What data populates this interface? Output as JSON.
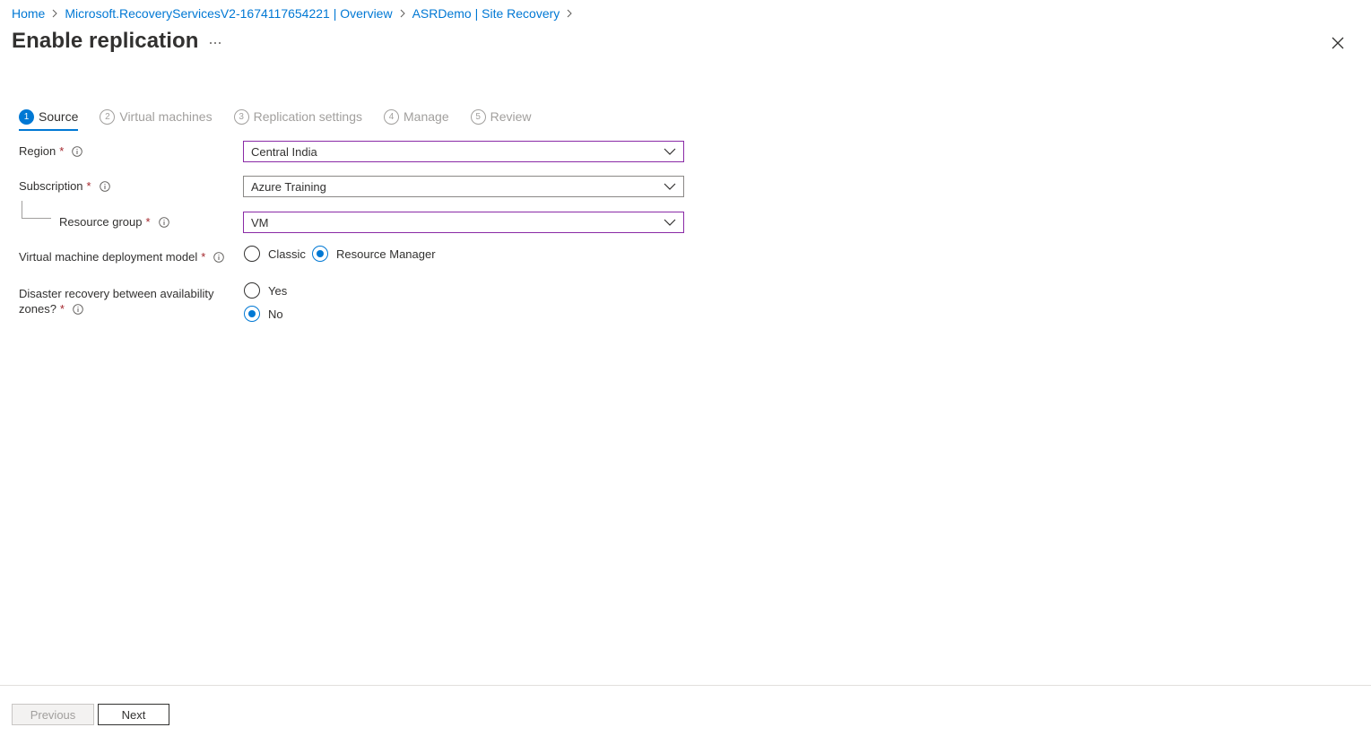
{
  "breadcrumb": [
    {
      "label": "Home"
    },
    {
      "label": "Microsoft.RecoveryServicesV2-1674117654221 | Overview"
    },
    {
      "label": "ASRDemo | Site Recovery"
    }
  ],
  "title": "Enable replication",
  "more_label": "...",
  "tabs": [
    {
      "num": "1",
      "label": "Source",
      "active": true
    },
    {
      "num": "2",
      "label": "Virtual machines"
    },
    {
      "num": "3",
      "label": "Replication settings"
    },
    {
      "num": "4",
      "label": "Manage"
    },
    {
      "num": "5",
      "label": "Review"
    }
  ],
  "form": {
    "region": {
      "label": "Region",
      "required": "*",
      "value": "Central India"
    },
    "subscription": {
      "label": "Subscription",
      "required": "*",
      "value": "Azure Training"
    },
    "resource_group": {
      "label": "Resource group",
      "required": "*",
      "value": "VM"
    },
    "deployment_model": {
      "label": "Virtual machine deployment model",
      "required": "*",
      "options": [
        "Classic",
        "Resource Manager"
      ],
      "selected": "Resource Manager"
    },
    "dr_zones": {
      "label_line1": "Disaster recovery between availability",
      "label_line2": "zones?",
      "required": "*",
      "options": [
        "Yes",
        "No"
      ],
      "selected": "No"
    }
  },
  "footer": {
    "previous": "Previous",
    "next": "Next"
  },
  "colors": {
    "accent": "#0078d4",
    "focus_border": "#8a2aa6",
    "required": "#a4262c"
  }
}
